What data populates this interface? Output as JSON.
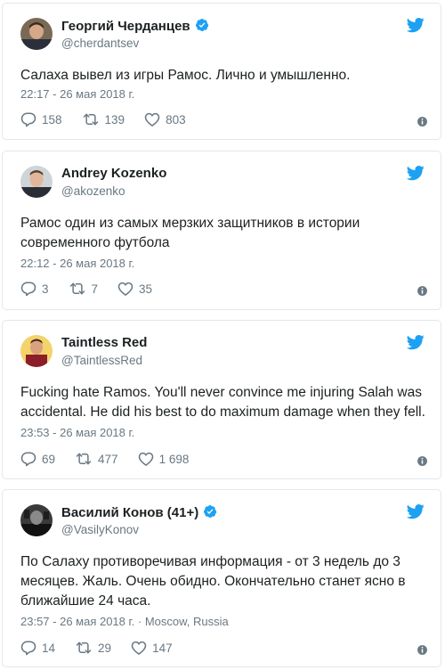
{
  "tweets": [
    {
      "name": "Георгий Черданцев",
      "verified": true,
      "handle": "@cherdantsev",
      "text": "Салаха вывел из игры Рамос. Лично и умышленно.",
      "time": "22:17 - 26 мая 2018 г.",
      "replies": "158",
      "retweets": "139",
      "likes": "803"
    },
    {
      "name": "Andrey Kozenko",
      "verified": false,
      "handle": "@akozenko",
      "text": "Рамос один из самых мерзких защитников в истории современного футбола",
      "time": "22:12 - 26 мая 2018 г.",
      "replies": "3",
      "retweets": "7",
      "likes": "35"
    },
    {
      "name": "Taintless Red",
      "verified": false,
      "handle": "@TaintlessRed",
      "text": "Fucking hate Ramos. You'll never convince me injuring Salah was accidental. He did his best to do maximum damage when they fell.",
      "time": "23:53 - 26 мая 2018 г.",
      "replies": "69",
      "retweets": "477",
      "likes": "1 698"
    },
    {
      "name": "Василий Конов (41+)",
      "verified": true,
      "handle": "@VasilyKonov",
      "text": "По Салаху противоречивая информация - от 3 недель до 3 месяцев. Жаль. Очень обидно. Окончательно станет ясно в ближайшие 24 часа.",
      "time": "23:57 - 26 мая 2018 г. · Moscow, Russia",
      "replies": "14",
      "retweets": "29",
      "likes": "147"
    }
  ],
  "colors": {
    "twitter_blue": "#1da1f2",
    "muted": "#697882",
    "border": "#e1e8ed"
  },
  "icons": [
    "twitter-bird-icon",
    "verified-badge-icon",
    "reply-icon",
    "retweet-icon",
    "like-icon",
    "info-icon"
  ]
}
